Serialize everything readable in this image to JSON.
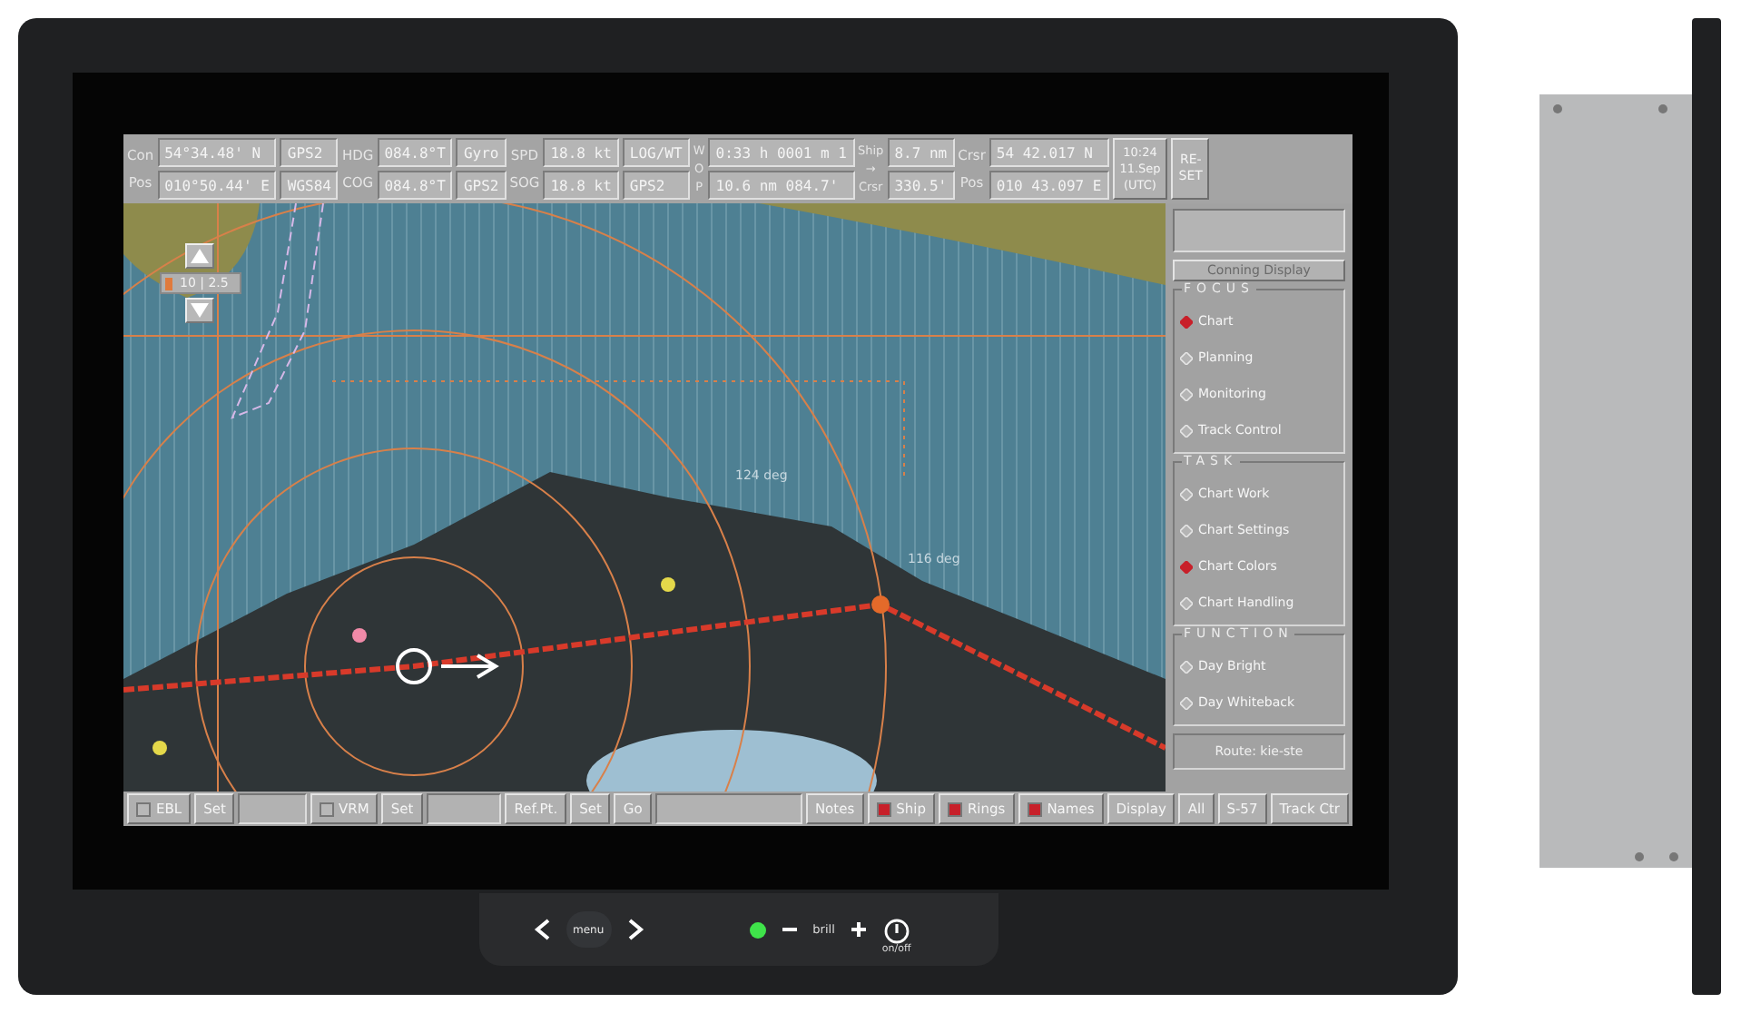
{
  "top_bar": {
    "columns": [
      {
        "kind": "label",
        "lines": [
          "Con",
          "Pos"
        ]
      },
      {
        "kind": "cells",
        "cells": [
          "54°34.48' N",
          "010°50.44' E"
        ]
      },
      {
        "kind": "cells",
        "cells": [
          "GPS2",
          "WGS84"
        ]
      },
      {
        "kind": "label",
        "lines": [
          "HDG",
          "COG"
        ]
      },
      {
        "kind": "cells",
        "cells": [
          "084.8°T",
          "084.8°T"
        ]
      },
      {
        "kind": "cells",
        "cells": [
          "Gyro",
          "GPS2"
        ]
      },
      {
        "kind": "label",
        "lines": [
          "SPD",
          "SOG"
        ]
      },
      {
        "kind": "cells",
        "cells": [
          "18.8 kt",
          "18.8 kt"
        ]
      },
      {
        "kind": "cells",
        "cells": [
          "LOG/WT",
          "GPS2"
        ]
      },
      {
        "kind": "label",
        "lines": [
          "W",
          "O",
          "P"
        ]
      },
      {
        "kind": "cells",
        "cells": [
          "0:33 h 0001 m 1",
          "10.6 nm 084.7'"
        ]
      },
      {
        "kind": "label",
        "lines": [
          "Ship",
          "→",
          "Crsr"
        ]
      },
      {
        "kind": "cells",
        "cells": [
          "8.7 nm",
          "330.5'"
        ]
      },
      {
        "kind": "label",
        "lines": [
          "Crsr",
          "Pos"
        ]
      },
      {
        "kind": "cells",
        "cells": [
          "54 42.017 N",
          "010 43.097 E"
        ]
      },
      {
        "kind": "button",
        "lines": [
          "10:24",
          "11.Sep",
          "(UTC)"
        ]
      },
      {
        "kind": "button",
        "lines": [
          "RE-",
          "SET"
        ]
      }
    ]
  },
  "chart": {
    "scale": "10 | 2.5",
    "labels": [
      "124 deg",
      "116 deg"
    ]
  },
  "side_panel": {
    "conning": {
      "label": "Conning Display",
      "disabled": true
    },
    "groups": [
      {
        "title": "FOCUS",
        "items": [
          {
            "label": "Chart",
            "selected": true
          },
          {
            "label": "Planning",
            "selected": false
          },
          {
            "label": "Monitoring",
            "selected": false
          },
          {
            "label": "Track Control",
            "selected": false
          }
        ]
      },
      {
        "title": "TASK",
        "items": [
          {
            "label": "Chart Work",
            "selected": false
          },
          {
            "label": "Chart Settings",
            "selected": false
          },
          {
            "label": "Chart Colors",
            "selected": true
          },
          {
            "label": "Chart Handling",
            "selected": false
          }
        ]
      },
      {
        "title": "FUNCTION",
        "items": [
          {
            "label": "Day Bright",
            "selected": false
          },
          {
            "label": "Day Whiteback",
            "selected": false
          }
        ]
      }
    ],
    "route": "Route: kie-ste"
  },
  "bottom_bar": [
    {
      "kind": "checkbox",
      "label": "EBL",
      "checked": false
    },
    {
      "kind": "button",
      "label": "Set"
    },
    {
      "kind": "field"
    },
    {
      "kind": "checkbox",
      "label": "VRM",
      "checked": false
    },
    {
      "kind": "button",
      "label": "Set"
    },
    {
      "kind": "field"
    },
    {
      "kind": "button",
      "label": "Ref.Pt."
    },
    {
      "kind": "button",
      "label": "Set"
    },
    {
      "kind": "button",
      "label": "Go"
    },
    {
      "kind": "field"
    },
    {
      "kind": "button",
      "label": "Notes"
    },
    {
      "kind": "checkbox",
      "label": "Ship",
      "checked": true
    },
    {
      "kind": "checkbox",
      "label": "Rings",
      "checked": true
    },
    {
      "kind": "checkbox",
      "label": "Names",
      "checked": true
    },
    {
      "kind": "button",
      "label": "Display"
    },
    {
      "kind": "button",
      "label": "All"
    },
    {
      "kind": "button",
      "label": "S-57"
    },
    {
      "kind": "button",
      "label": "Track Ctr"
    }
  ],
  "bezel": {
    "menu_label": "menu",
    "brightness_label": "brill",
    "power_label": "on/off",
    "led_on": true
  }
}
